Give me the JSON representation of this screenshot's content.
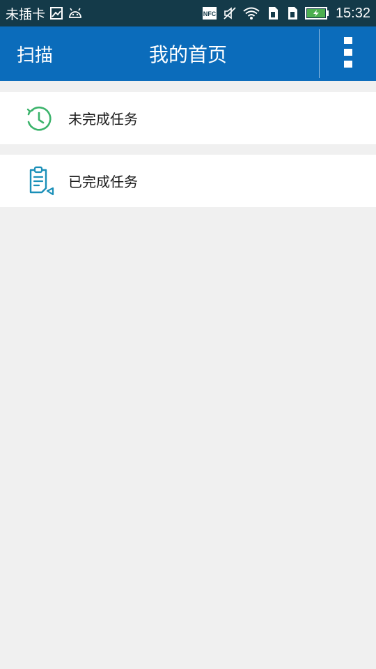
{
  "status_bar": {
    "carrier": "未插卡",
    "time": "15:32",
    "icons": [
      "image-icon",
      "android-icon",
      "nfc-icon",
      "mute-icon",
      "wifi-icon",
      "sim1-icon",
      "sim2-icon",
      "battery-icon"
    ],
    "battery_color": "#4caf50"
  },
  "app_bar": {
    "scan_label": "扫描",
    "title": "我的首页",
    "background": "#0b6cbb"
  },
  "menu": {
    "items": [
      {
        "label": "未完成任务",
        "icon": "clock-refresh-icon",
        "icon_color": "#3bb36b"
      },
      {
        "label": "已完成任务",
        "icon": "clipboard-edit-icon",
        "icon_color": "#1a8fb8"
      }
    ]
  }
}
